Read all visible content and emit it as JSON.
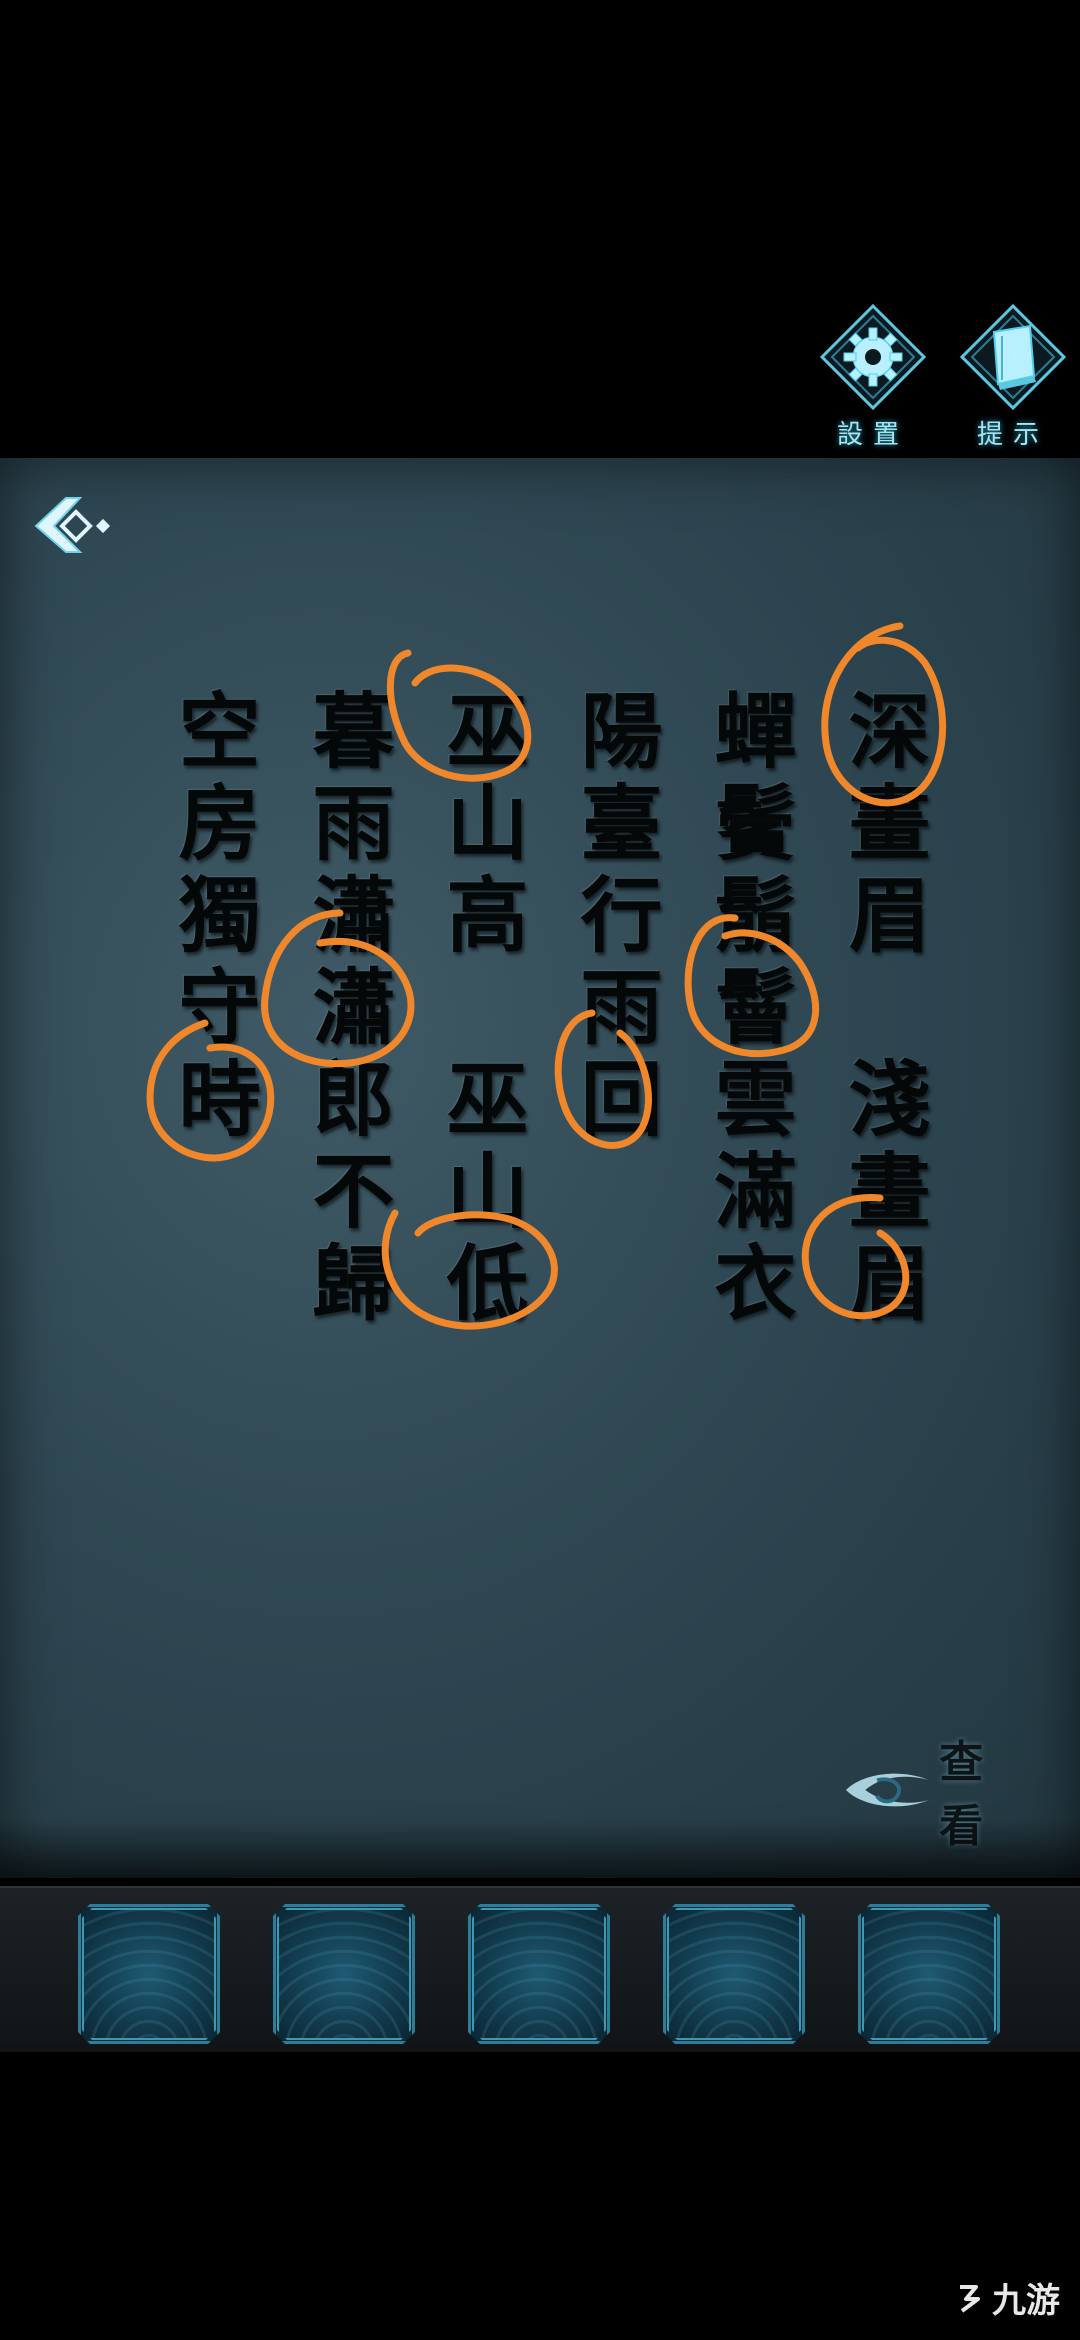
{
  "top_menu": {
    "settings_label": "設置",
    "hint_label": "提示"
  },
  "poem": {
    "columns": [
      "深畫眉　淺畫眉",
      "蟬鬢鬅鬙雲滿衣",
      "陽臺行雨回",
      "巫山高　巫山低",
      "暮雨瀟瀟郎不歸",
      "空房獨守時"
    ]
  },
  "view_button": {
    "label": "查看"
  },
  "inventory": {
    "slots": 5
  },
  "watermark": {
    "text": "九游"
  },
  "colors": {
    "panel": "#2f4853",
    "ink": "#050809",
    "marker": "#f0872a",
    "glow": "#2ab4d6"
  }
}
